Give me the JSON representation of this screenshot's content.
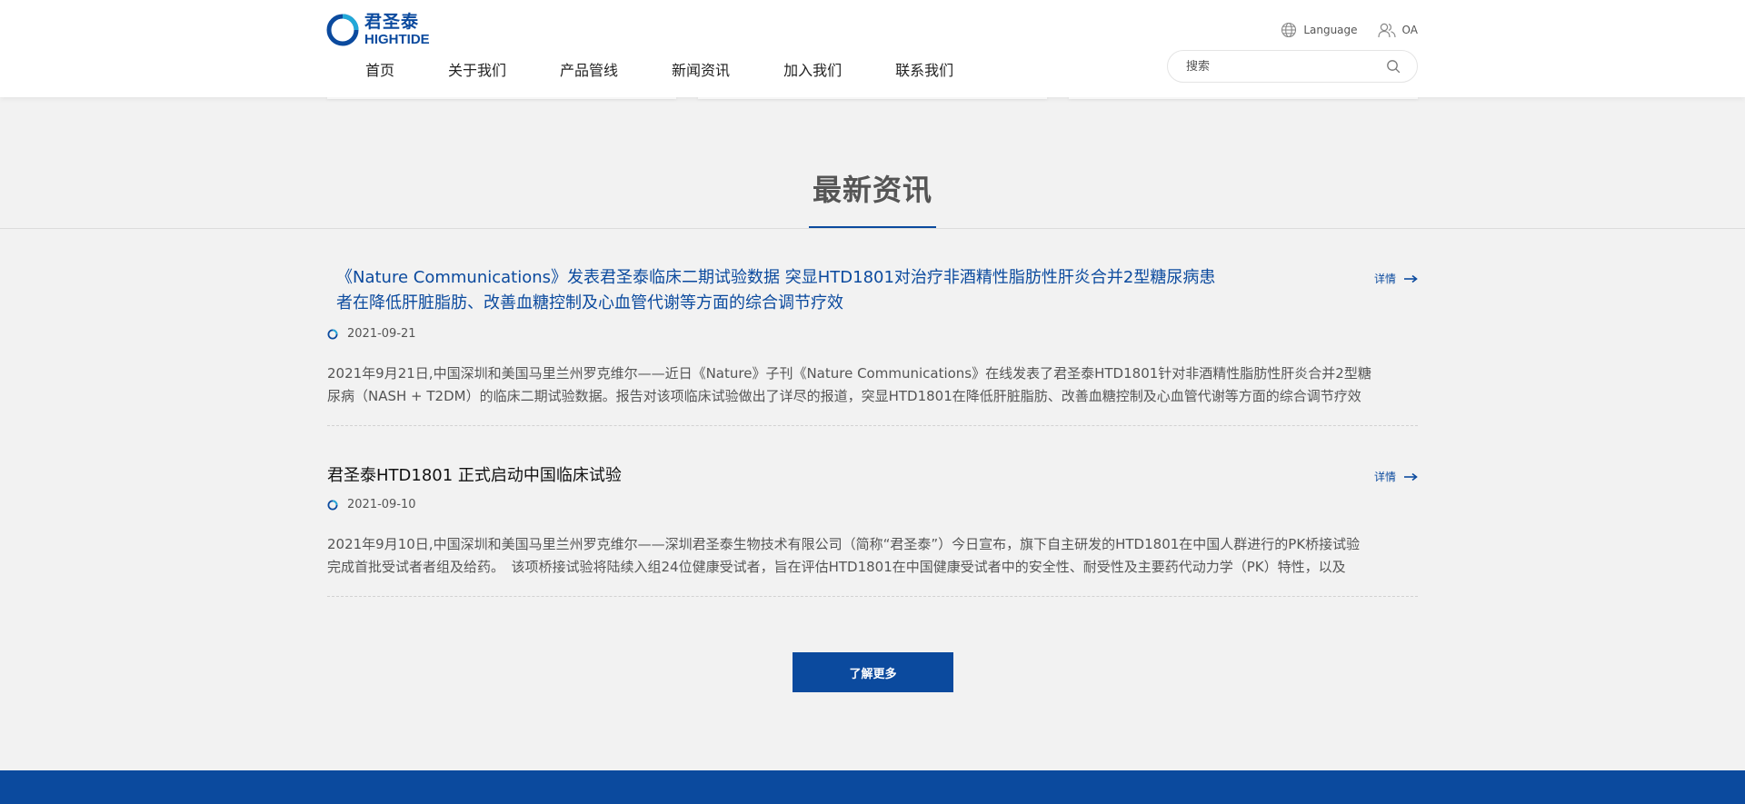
{
  "brand": {
    "name_cn": "君圣泰",
    "name_en": "HIGHTIDE",
    "primary_color": "#0b4a9e"
  },
  "nav": {
    "items": [
      {
        "label": "首页"
      },
      {
        "label": "关于我们"
      },
      {
        "label": "产品管线"
      },
      {
        "label": "新闻资讯"
      },
      {
        "label": "加入我们"
      },
      {
        "label": "联系我们"
      }
    ]
  },
  "top_links": {
    "language": {
      "label": "Language",
      "icon": "globe-icon"
    },
    "oa": {
      "label": "OA",
      "icon": "users-icon"
    }
  },
  "search": {
    "placeholder": "搜索",
    "value": "",
    "icon": "search-icon"
  },
  "section": {
    "title": "最新资讯"
  },
  "news": [
    {
      "title": "《Nature Communications》发表君圣泰临床二期试验数据 突显HTD1801对治疗非酒精性脂肪性肝炎合并2型糖尿病患者在降低肝脏脂肪、改善血糖控制及心血管代谢等方面的综合调节疗效",
      "date": "2021-09-21",
      "more_label": "详情",
      "summary_line1": "2021年9月21日,中国深圳和美国马里兰州罗克维尔——近日《Nature》子刊《Nature Communications》在线发表了君圣泰HTD1801针对非酒精性脂肪性肝炎合并2型糖",
      "summary_line2": "尿病（NASH + T2DM）的临床二期试验数据。报告对该项临床试验做出了详尽的报道，突显HTD1801在降低肝脏脂肪、改善血糖控制及心血管代谢等方面的综合调节疗效"
    },
    {
      "title": "君圣泰HTD1801 正式启动中国临床试验",
      "date": "2021-09-10",
      "more_label": "详情",
      "summary_line1": "2021年9月10日,中国深圳和美国马里兰州罗克维尔——深圳君圣泰生物技术有限公司（简称“君圣泰”）今日宣布，旗下自主研发的HTD1801在中国人群进行的PK桥接试验",
      "summary_line2": "完成首批受试者者组及给药。　该项桥接试验将陆续入组24位健康受试者，旨在评估HTD1801在中国健康受试者中的安全性、耐受性及主要药代动力学（PK）特性，以及"
    }
  ],
  "more_button": {
    "label": "了解更多"
  }
}
